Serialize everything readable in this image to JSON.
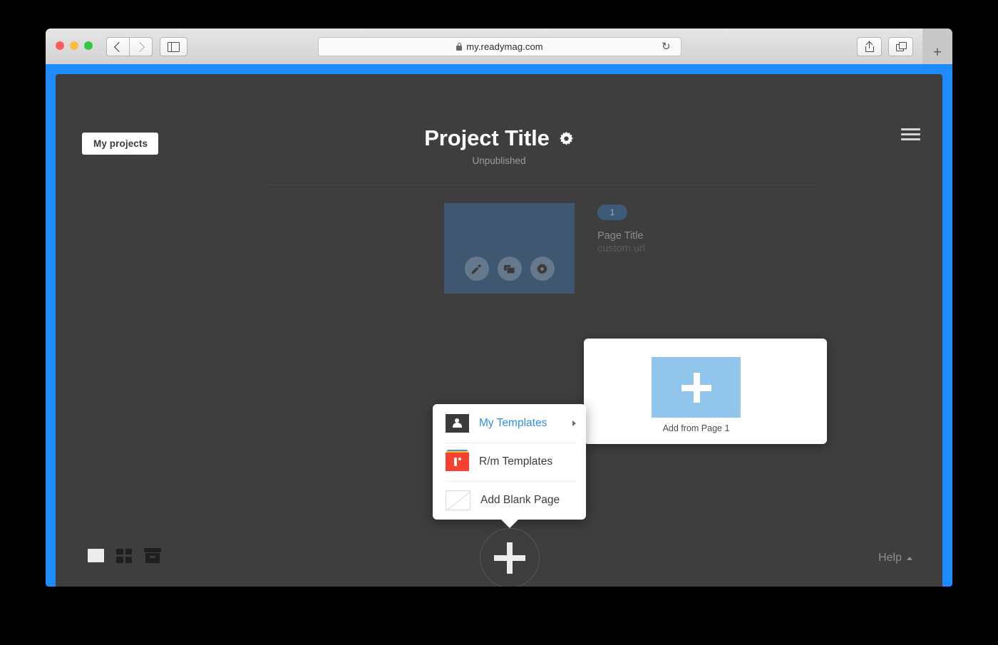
{
  "browser": {
    "url": "my.readymag.com",
    "lock_icon": "lock-icon",
    "reload_icon": "reload-icon",
    "back_icon": "chevron-left-icon",
    "forward_icon": "chevron-right-icon",
    "sidebar_icon": "sidebar-toggle-icon",
    "share_icon": "share-icon",
    "tabs_icon": "show-tabs-icon",
    "new_tab_label": "+",
    "traffic_lights": {
      "close": "#fc5d57",
      "minimize": "#fdbc40",
      "maximize": "#33c748"
    }
  },
  "app": {
    "accent_frame_color": "#1e8bff",
    "background_color": "#3e3e3e",
    "back_button_label": "My projects",
    "menu_icon": "hamburger-menu-icon",
    "header": {
      "title": "Project Title",
      "settings_icon": "gear-icon",
      "status": "Unpublished"
    },
    "page_card": {
      "badge": "1",
      "name": "Page Title",
      "url": "custom url",
      "thumb_color": "#3f5770",
      "actions": [
        {
          "icon": "pencil-icon",
          "name": "edit-page-button"
        },
        {
          "icon": "duplicate-icon",
          "name": "duplicate-page-button"
        },
        {
          "icon": "gear-icon",
          "name": "page-settings-button"
        }
      ]
    },
    "add_panel": {
      "caption": "Add from Page 1",
      "thumb_color": "#92c5ec",
      "plus_icon": "plus-icon"
    },
    "context_menu": {
      "items": [
        {
          "label": "My Templates",
          "icon": "user-icon",
          "active": true,
          "has_submenu": true
        },
        {
          "label": "R/m Templates",
          "icon": "readymag-templates-icon",
          "active": false,
          "has_submenu": false
        },
        {
          "label": "Add Blank Page",
          "icon": "blank-page-icon",
          "active": false,
          "has_submenu": false
        }
      ],
      "active_color": "#2f8fef"
    },
    "add_page_button": {
      "icon": "plus-icon"
    },
    "view_modes": [
      {
        "name": "single-view",
        "icon": "single-rect-icon",
        "active": true
      },
      {
        "name": "grid-view",
        "icon": "grid-icon",
        "active": false
      },
      {
        "name": "archive-view",
        "icon": "archive-box-icon",
        "active": false
      }
    ],
    "help": {
      "label": "Help",
      "caret_icon": "caret-up-icon"
    }
  }
}
